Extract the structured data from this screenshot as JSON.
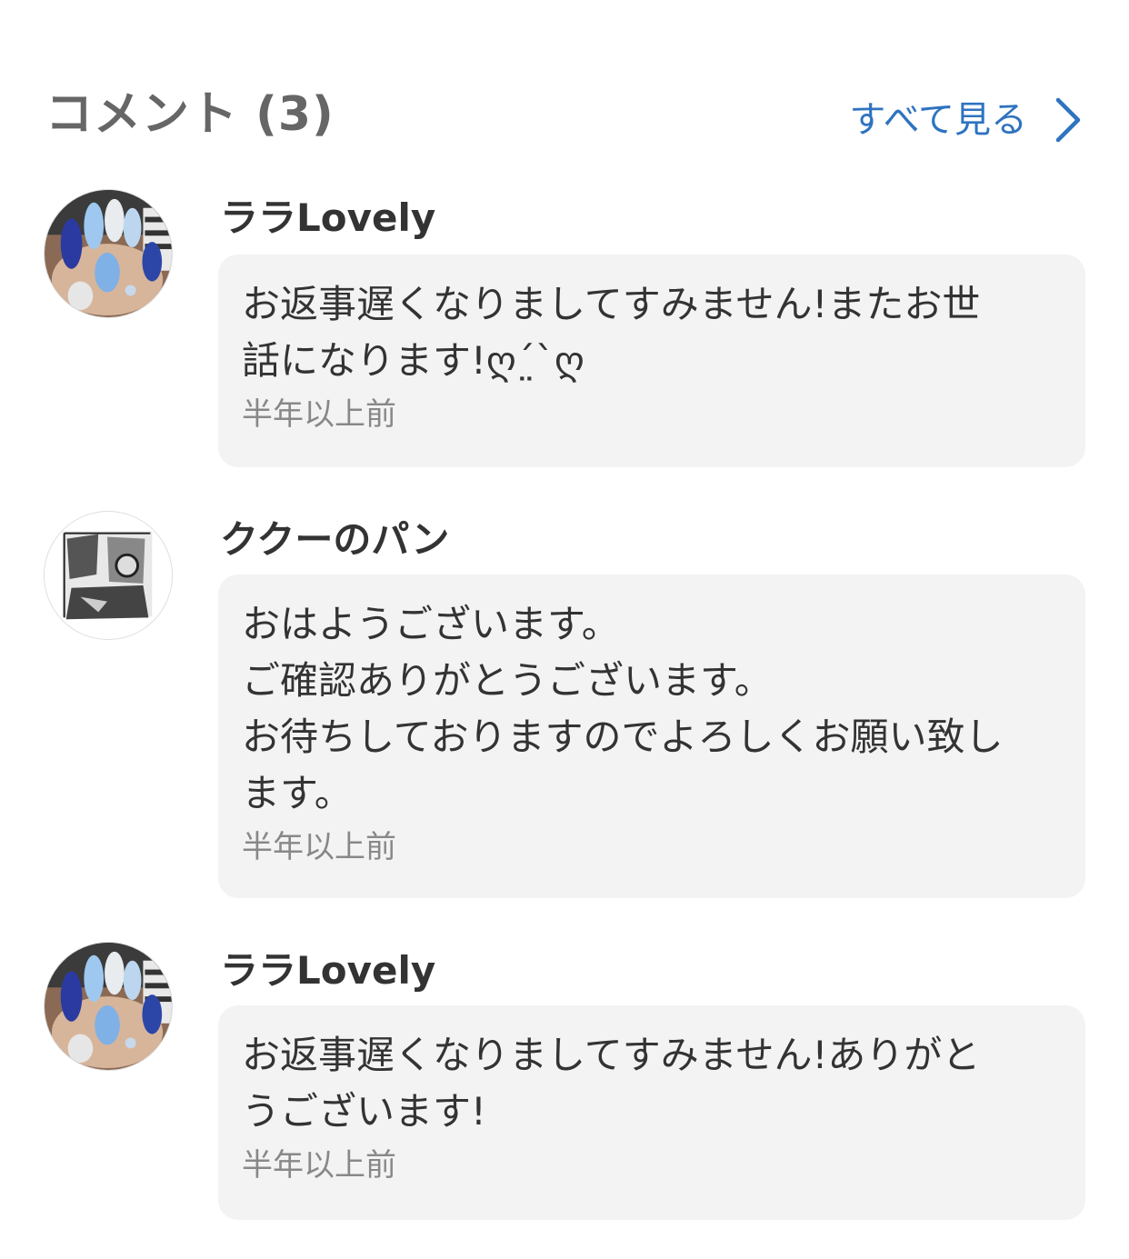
{
  "header": {
    "title": "コメント (3)",
    "see_all_label": "すべて見る",
    "accent_color": "#2f73c0"
  },
  "comments": [
    {
      "username": "ララLovely",
      "body": "お返事遅くなりましてすみません!またお世\n話になります!ღˊ̤ˋღ",
      "time": "半年以上前",
      "avatar_icon": "nail-art-avatar"
    },
    {
      "username": "ククーのパン",
      "body": "おはようございます。\nご確認ありがとうございます。\nお待ちしておりますのでよろしくお願い致し\nます。",
      "time": "半年以上前",
      "avatar_icon": "sketch-illustration-avatar"
    },
    {
      "username": "ララLovely",
      "body": "お返事遅くなりましてすみません!ありがと\nうございます!",
      "time": "半年以上前",
      "avatar_icon": "nail-art-avatar"
    }
  ]
}
